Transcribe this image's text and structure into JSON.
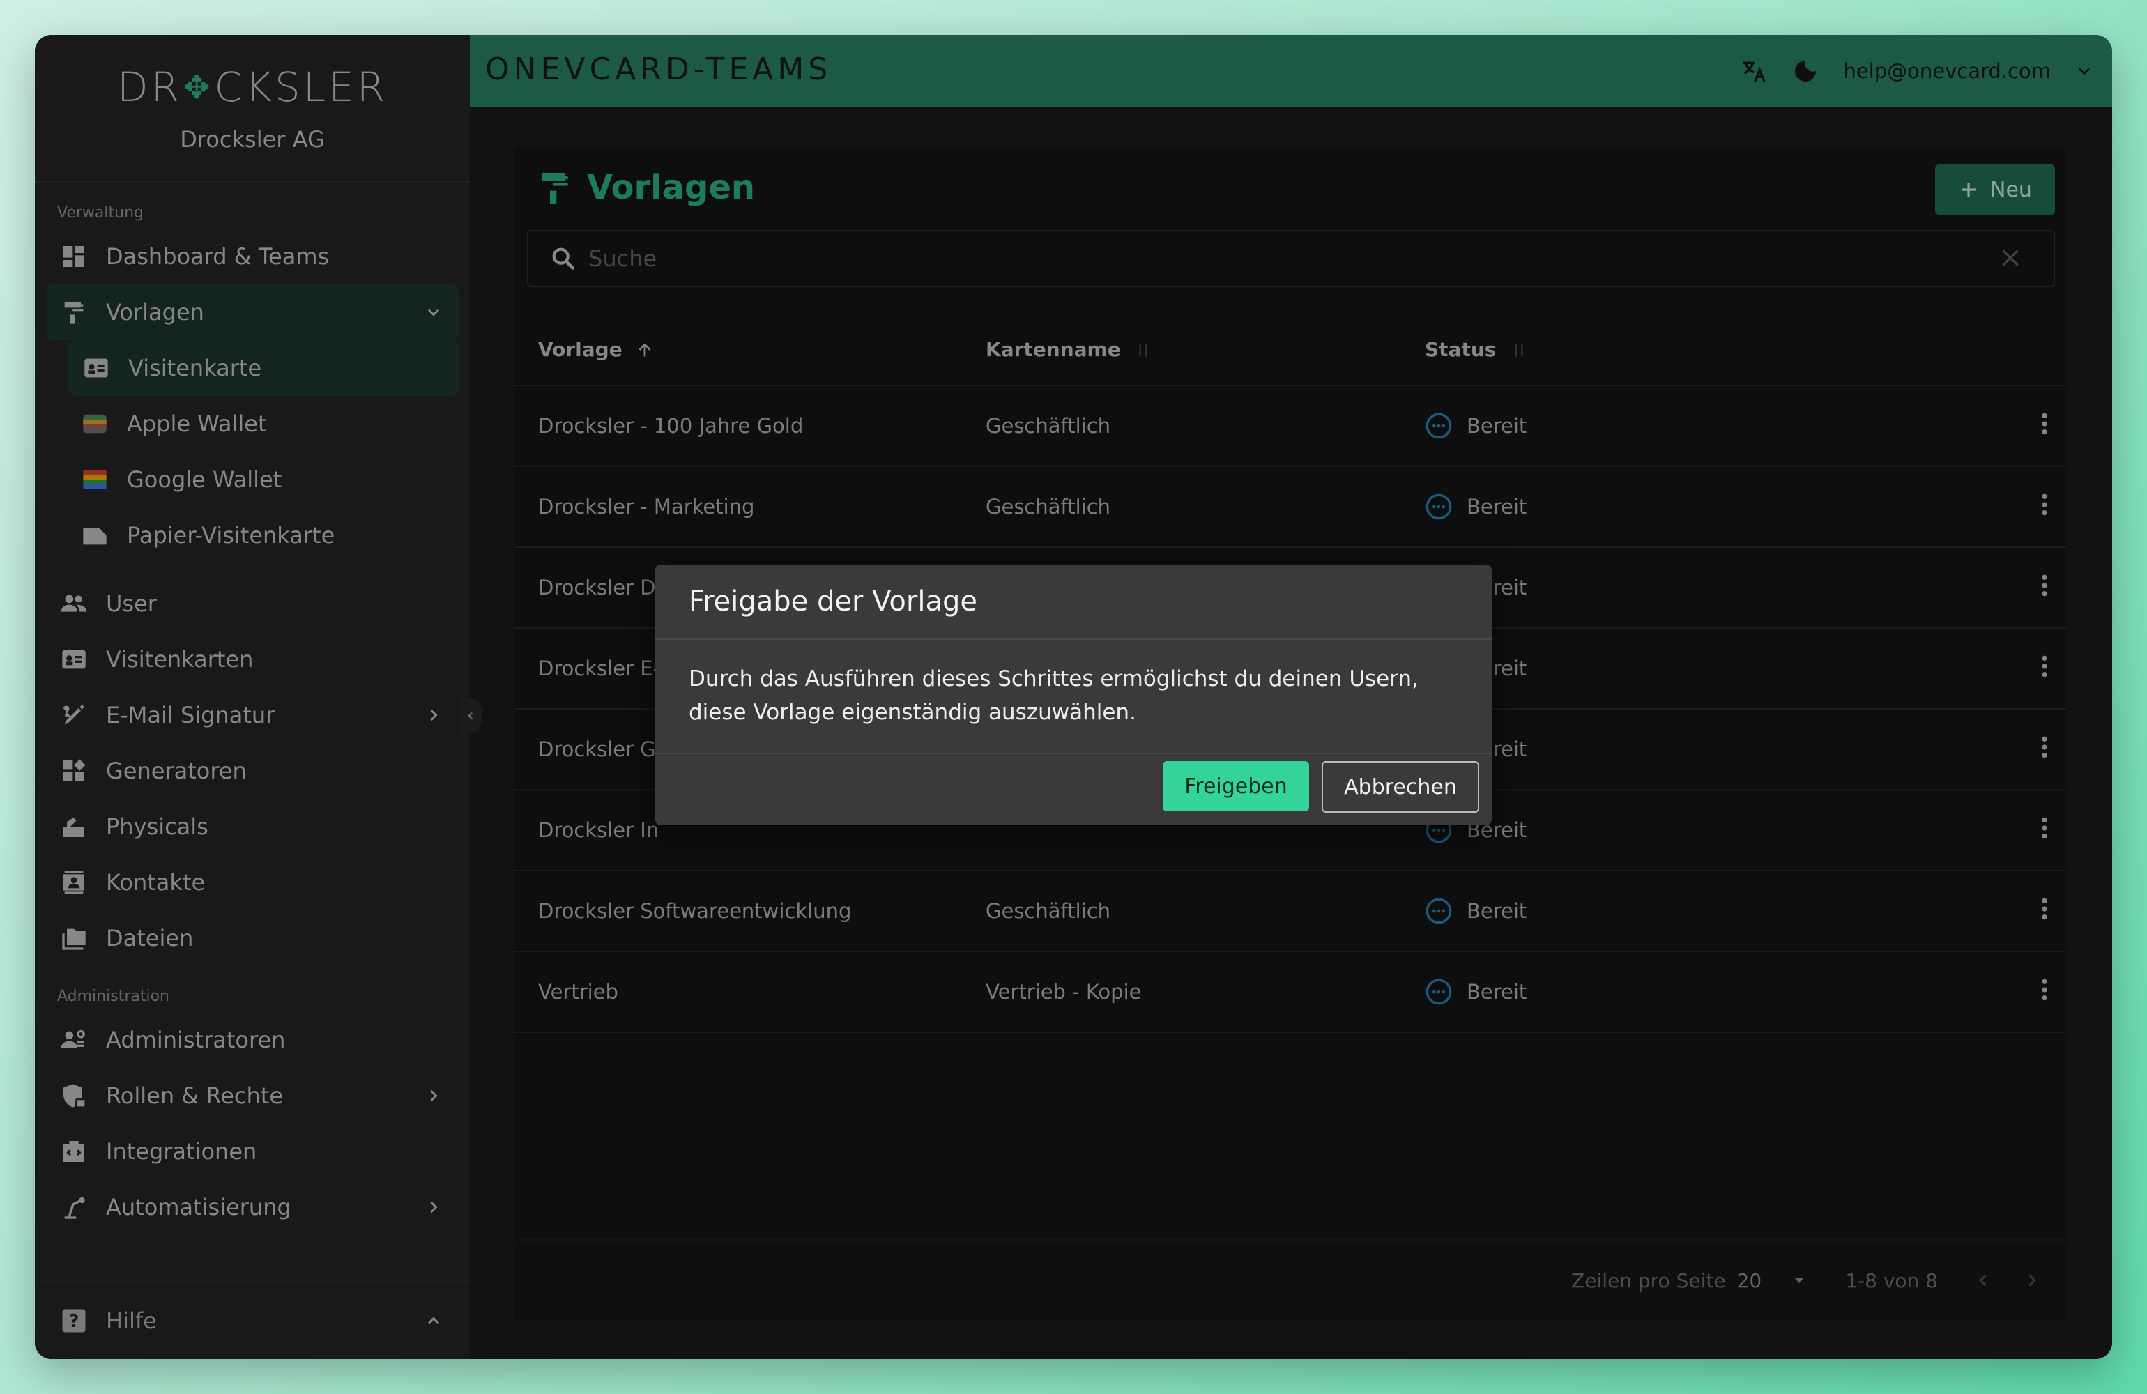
{
  "brand": {
    "logo_text_left": "DR",
    "logo_text_right": "CKSLER",
    "company": "Drocksler AG"
  },
  "app_title": "ONEVCARD-TEAMS",
  "user_email": "help@onevcard.com",
  "sidebar": {
    "section_verwaltung": "Verwaltung",
    "items": [
      {
        "label": "Dashboard & Teams"
      },
      {
        "label": "Vorlagen"
      },
      {
        "label": "Visitenkarte"
      },
      {
        "label": "Apple Wallet"
      },
      {
        "label": "Google Wallet"
      },
      {
        "label": "Papier-Visitenkarte"
      },
      {
        "label": "User"
      },
      {
        "label": "Visitenkarten"
      },
      {
        "label": "E-Mail Signatur"
      },
      {
        "label": "Generatoren"
      },
      {
        "label": "Physicals"
      },
      {
        "label": "Kontakte"
      },
      {
        "label": "Dateien"
      }
    ],
    "section_administration": "Administration",
    "admin_items": [
      {
        "label": "Administratoren"
      },
      {
        "label": "Rollen & Rechte"
      },
      {
        "label": "Integrationen"
      },
      {
        "label": "Automatisierung"
      }
    ],
    "help": "Hilfe"
  },
  "page": {
    "title": "Vorlagen",
    "new_button": "Neu",
    "search_placeholder": "Suche",
    "columns": {
      "vorlage": "Vorlage",
      "kartenname": "Kartenname",
      "status": "Status"
    },
    "rows": [
      {
        "vorlage": "Drocksler - 100 Jahre Gold",
        "kartenname": "Geschäftlich",
        "status": "Bereit"
      },
      {
        "vorlage": "Drocksler - Marketing",
        "kartenname": "Geschäftlich",
        "status": "Bereit"
      },
      {
        "vorlage": "Drocksler Di",
        "kartenname": "",
        "status": "Bereit"
      },
      {
        "vorlage": "Drocksler E-",
        "kartenname": "",
        "status": "Bereit"
      },
      {
        "vorlage": "Drocksler Ge",
        "kartenname": "",
        "status": "Bereit"
      },
      {
        "vorlage": "Drocksler In",
        "kartenname": "",
        "status": "Bereit"
      },
      {
        "vorlage": "Drocksler Softwareentwicklung",
        "kartenname": "Geschäftlich",
        "status": "Bereit"
      },
      {
        "vorlage": "Vertrieb",
        "kartenname": "Vertrieb - Kopie",
        "status": "Bereit"
      }
    ],
    "footer": {
      "rows_per_page_label": "Zeilen pro Seite",
      "rows_per_page_value": "20",
      "range": "1-8 von 8"
    }
  },
  "dialog": {
    "title": "Freigabe der Vorlage",
    "body": "Durch das Ausführen dieses Schrittes ermöglichst du deinen Usern, diese Vorlage eigenständig auszuwählen.",
    "confirm": "Freigeben",
    "cancel": "Abbrechen"
  },
  "colors": {
    "accent": "#2bbf8f",
    "topbar": "#2c8a6b",
    "status": "#2a8cc4"
  }
}
